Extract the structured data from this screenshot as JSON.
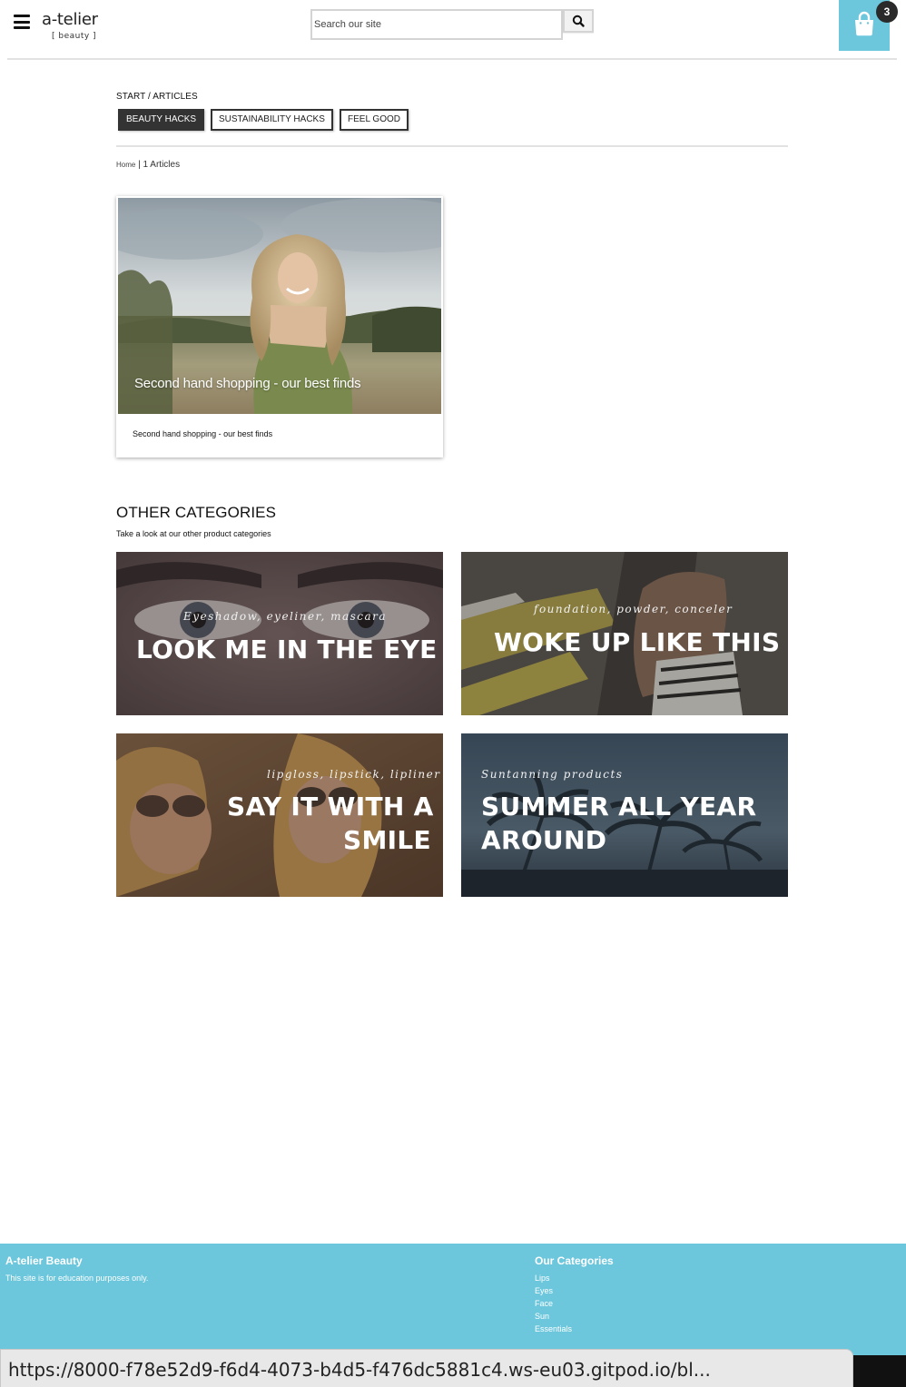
{
  "header": {
    "logo_main": "a-telier",
    "logo_sub": "[ beauty ]",
    "search_placeholder": "Search our site",
    "cart_count": "3"
  },
  "breadcrumb": {
    "top": "START / ARTICLES",
    "home": "Home",
    "separator": "|",
    "count_text": "1 Articles"
  },
  "filters": [
    {
      "label": "BEAUTY HACKS",
      "active": true
    },
    {
      "label": "SUSTAINABILITY HACKS",
      "active": false
    },
    {
      "label": "FEEL GOOD",
      "active": false
    }
  ],
  "article": {
    "overlay_title": "Second hand shopping - our best finds",
    "caption": "Second hand shopping - our best finds"
  },
  "other_categories": {
    "title": "OTHER CATEGORIES",
    "subtitle": "Take a look at our other product categories",
    "tiles": [
      {
        "kicker": "Eyeshadow, eyeliner, mascara",
        "heading": "LOOK ME IN THE EYE",
        "heading_2": ""
      },
      {
        "kicker": "foundation, powder, conceler",
        "heading": "WOKE UP LIKE THIS",
        "heading_2": ""
      },
      {
        "kicker": "lipgloss, lipstick, lipliner",
        "heading": "SAY IT WITH A",
        "heading_2": "SMILE"
      },
      {
        "kicker": "Suntanning products",
        "heading": "SUMMER ALL YEAR",
        "heading_2": "AROUND"
      }
    ]
  },
  "footer": {
    "brand": "A-telier Beauty",
    "note": "This site is for education purposes only.",
    "categories_title": "Our Categories",
    "links": [
      "Lips",
      "Eyes",
      "Face",
      "Sun",
      "Essentials"
    ]
  },
  "status": {
    "url": "https://8000-f78e52d9-f6d4-4073-b4d5-f476dc5881c4.ws-eu03.gitpod.io/bl..."
  },
  "colors": {
    "accent": "#6cc6dc",
    "dark": "#333333"
  }
}
